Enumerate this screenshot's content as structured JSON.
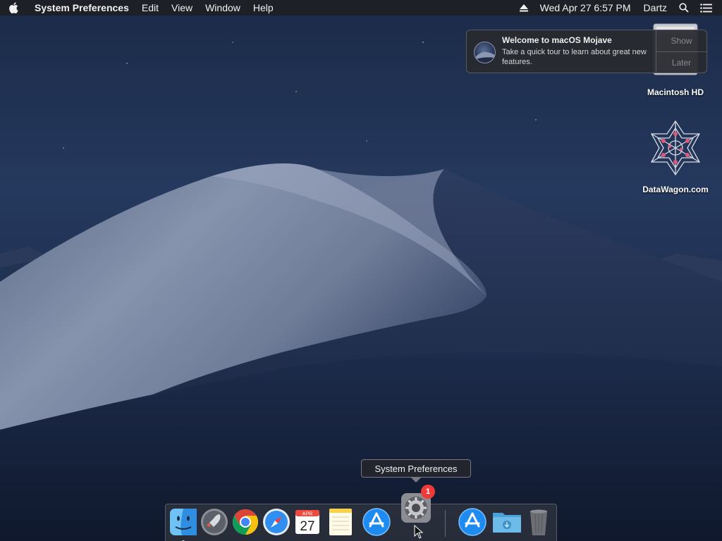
{
  "menubar": {
    "app_name": "System Preferences",
    "menus": [
      "Edit",
      "View",
      "Window",
      "Help"
    ],
    "datetime": "Wed Apr 27  6:57 PM",
    "user": "Dartz",
    "icons": [
      "apple-icon",
      "eject-icon",
      "spotlight-search-icon",
      "notification-center-icon"
    ]
  },
  "notification": {
    "title": "Welcome to macOS Mojave",
    "body": "Take a quick tour to learn about great new features.",
    "show_label": "Show",
    "later_label": "Later"
  },
  "desktop": {
    "icons": [
      {
        "label": "Macintosh HD",
        "icon": "hard-drive-icon"
      },
      {
        "label": "DataWagon.com",
        "icon": "datawagon-logo-icon"
      }
    ]
  },
  "tooltip": {
    "text": "System Preferences"
  },
  "dock": {
    "items": [
      {
        "name": "Finder",
        "icon": "finder-icon",
        "running": true
      },
      {
        "name": "Launchpad",
        "icon": "launchpad-icon"
      },
      {
        "name": "Google Chrome",
        "icon": "chrome-icon"
      },
      {
        "name": "Safari",
        "icon": "safari-icon"
      },
      {
        "name": "Calendar",
        "icon": "calendar-icon",
        "month": "APR",
        "day": "27"
      },
      {
        "name": "Notes",
        "icon": "notes-icon"
      },
      {
        "name": "App Store",
        "icon": "app-store-icon"
      },
      {
        "name": "System Preferences",
        "icon": "system-preferences-icon",
        "badge": "1"
      },
      {
        "name": "App Store Downloads",
        "icon": "app-store-icon"
      },
      {
        "name": "Downloads",
        "icon": "downloads-folder-icon"
      },
      {
        "name": "Trash",
        "icon": "trash-icon"
      }
    ]
  },
  "colors": {
    "badge_red": "#f03a3a",
    "menubar_bg": "#1e2026",
    "desert_dune": "#7c8aa6"
  }
}
